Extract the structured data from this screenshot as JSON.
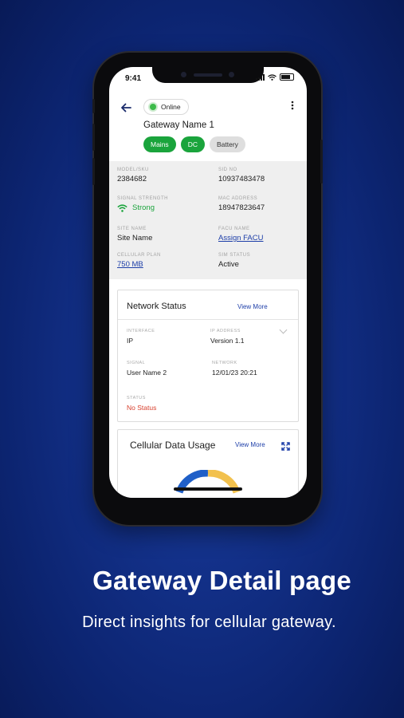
{
  "status_bar": {
    "time": "9:41"
  },
  "header": {
    "status": "Online",
    "gateway_name": "Gateway Name 1",
    "chips": [
      {
        "label": "Mains",
        "style": "green"
      },
      {
        "label": "DC",
        "style": "green"
      },
      {
        "label": "Battery",
        "style": "grey"
      }
    ]
  },
  "info": {
    "model_sku": {
      "label": "MODEL/SKU",
      "value": "2384682"
    },
    "sid_no": {
      "label": "SID NO",
      "value": "10937483478"
    },
    "signal_strength": {
      "label": "SIGNAL STRENGTH",
      "value": "Strong"
    },
    "mac_address": {
      "label": "MAC ADDRESS",
      "value": "18947823647"
    },
    "site_name": {
      "label": "SITE NAME",
      "value": "Site Name"
    },
    "facu_name": {
      "label": "FACU NAME",
      "value": "Assign FACU"
    },
    "cellular_plan": {
      "label": "CELLULAR PLAN",
      "value": "750 MB"
    },
    "sim_status": {
      "label": "SIM STATUS",
      "value": "Active"
    }
  },
  "network_status": {
    "title": "Network Status",
    "view_more": "View More",
    "interface": {
      "label": "INTERFACE",
      "value": "IP"
    },
    "ip_address": {
      "label": "IP ADDRESS",
      "value": "Version 1.1"
    },
    "signal": {
      "label": "SIGNAL",
      "value": "User Name 2"
    },
    "network": {
      "label": "NETWORK",
      "value": "12/01/23 20:21"
    },
    "status": {
      "label": "STATUS",
      "value": "No Status"
    }
  },
  "cellular_usage": {
    "title": "Cellular Data Usage",
    "view_more": "View More"
  },
  "promo": {
    "headline": "Gateway Detail page",
    "subline": "Direct insights for cellular gateway."
  },
  "colors": {
    "brand_blue": "#1d3ea8",
    "online_green": "#3dbb4a",
    "chip_green": "#1aa43c",
    "error_red": "#d8412f",
    "gauge_blue": "#1f5fc8",
    "gauge_yellow": "#f2c14e"
  }
}
